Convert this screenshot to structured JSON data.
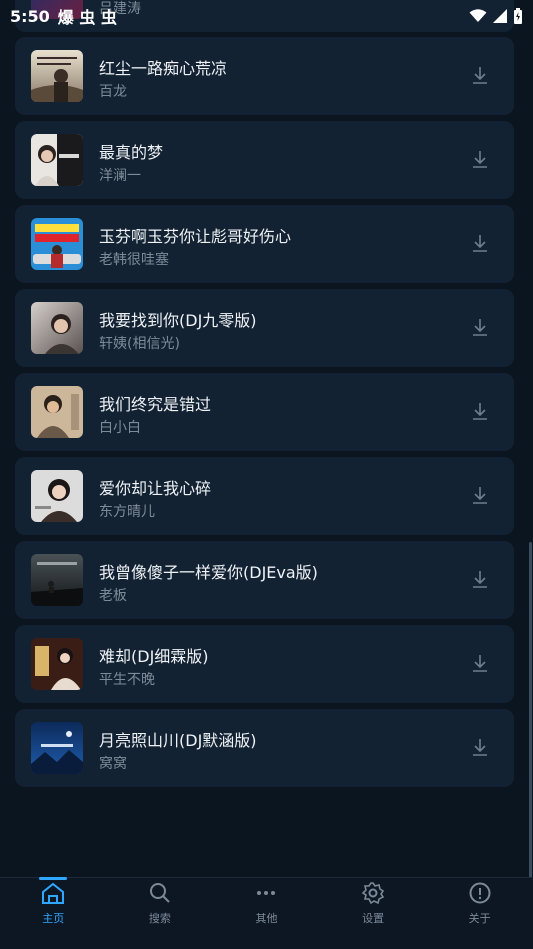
{
  "status": {
    "time": "5:50",
    "notif": "爆 虫 虫"
  },
  "partial_top": {
    "artist": "吕建涛"
  },
  "songs": [
    {
      "title": "红尘一路痴心荒凉",
      "artist": "百龙"
    },
    {
      "title": "最真的梦",
      "artist": "洋澜一"
    },
    {
      "title": "玉芬啊玉芬你让彪哥好伤心",
      "artist": "老韩很哇塞"
    },
    {
      "title": "我要找到你(DJ九零版)",
      "artist": "轩姨(相信光)"
    },
    {
      "title": "我们终究是错过",
      "artist": "白小白"
    },
    {
      "title": "爱你却让我心碎",
      "artist": "东方晴儿"
    },
    {
      "title": "我曾像傻子一样爱你(DJEva版)",
      "artist": "老板"
    },
    {
      "title": "难却(DJ细霖版)",
      "artist": "平生不晚"
    },
    {
      "title": "月亮照山川(DJ默涵版)",
      "artist": "窝窝"
    }
  ],
  "nav": [
    {
      "label": "主页",
      "icon": "home-icon",
      "active": true
    },
    {
      "label": "搜索",
      "icon": "search-icon",
      "active": false
    },
    {
      "label": "其他",
      "icon": "more-icon",
      "active": false
    },
    {
      "label": "设置",
      "icon": "gear-icon",
      "active": false
    },
    {
      "label": "关于",
      "icon": "info-icon",
      "active": false
    }
  ],
  "colors": {
    "accent": "#2fa6ff",
    "card": "#132232",
    "background": "#0b1520"
  }
}
